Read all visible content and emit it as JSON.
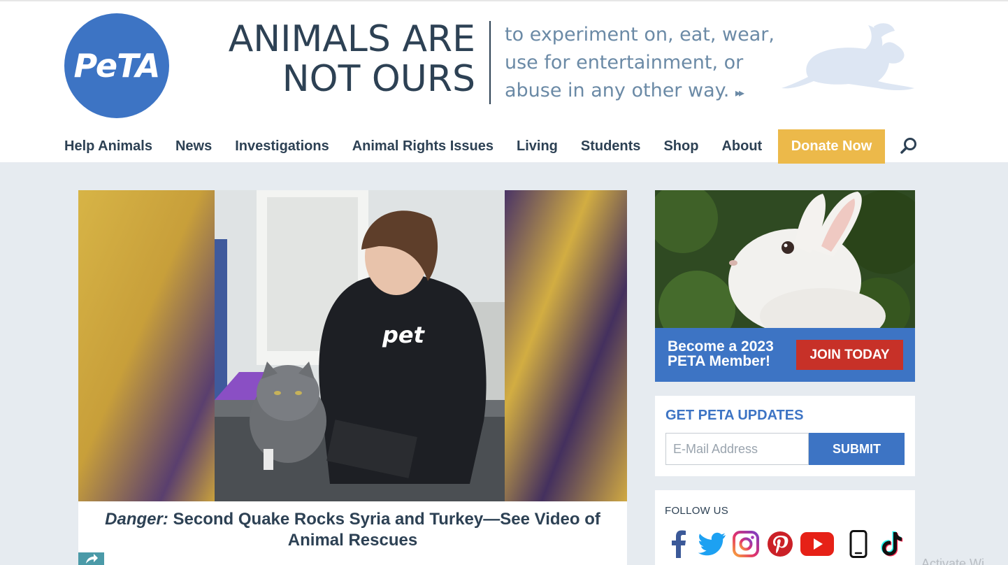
{
  "logo": {
    "text": "PeTA"
  },
  "tagline": {
    "main_line1": "ANIMALS ARE",
    "main_line2": "NOT OURS",
    "sub_line1": "to experiment on, eat, wear,",
    "sub_line2": "use for entertainment, or",
    "sub_line3": "abuse in any other way.",
    "arrows": "▸▸"
  },
  "nav": {
    "items": [
      {
        "label": "Help Animals"
      },
      {
        "label": "News"
      },
      {
        "label": "Investigations"
      },
      {
        "label": "Animal Rights Issues"
      },
      {
        "label": "Living"
      },
      {
        "label": "Students"
      },
      {
        "label": "Shop"
      },
      {
        "label": "About"
      }
    ],
    "donate_label": "Donate Now",
    "search_icon": "search-icon"
  },
  "feature": {
    "caption_emphasis": "Danger:",
    "caption_text": " Second Quake Rocks Syria and Turkey—See Video of Animal Rescues",
    "image_shirt_text": "pet"
  },
  "promo": {
    "line1": "Become a 2023",
    "line2": "PETA Member!",
    "join_label": "JOIN TODAY"
  },
  "updates": {
    "title": "GET PETA UPDATES",
    "email_placeholder": "E-Mail Address",
    "submit_label": "SUBMIT"
  },
  "follow": {
    "title": "FOLLOW US",
    "networks": [
      "facebook-icon",
      "twitter-icon",
      "instagram-icon",
      "pinterest-icon",
      "youtube-icon",
      "mobile-icon",
      "tiktok-icon"
    ]
  },
  "watermark": "Activate Wi",
  "colors": {
    "brand_blue": "#3d74c4",
    "navy_text": "#2d4154",
    "donate_gold": "#ecb94a",
    "join_red": "#c73128",
    "page_bg": "#e6ebf0"
  }
}
